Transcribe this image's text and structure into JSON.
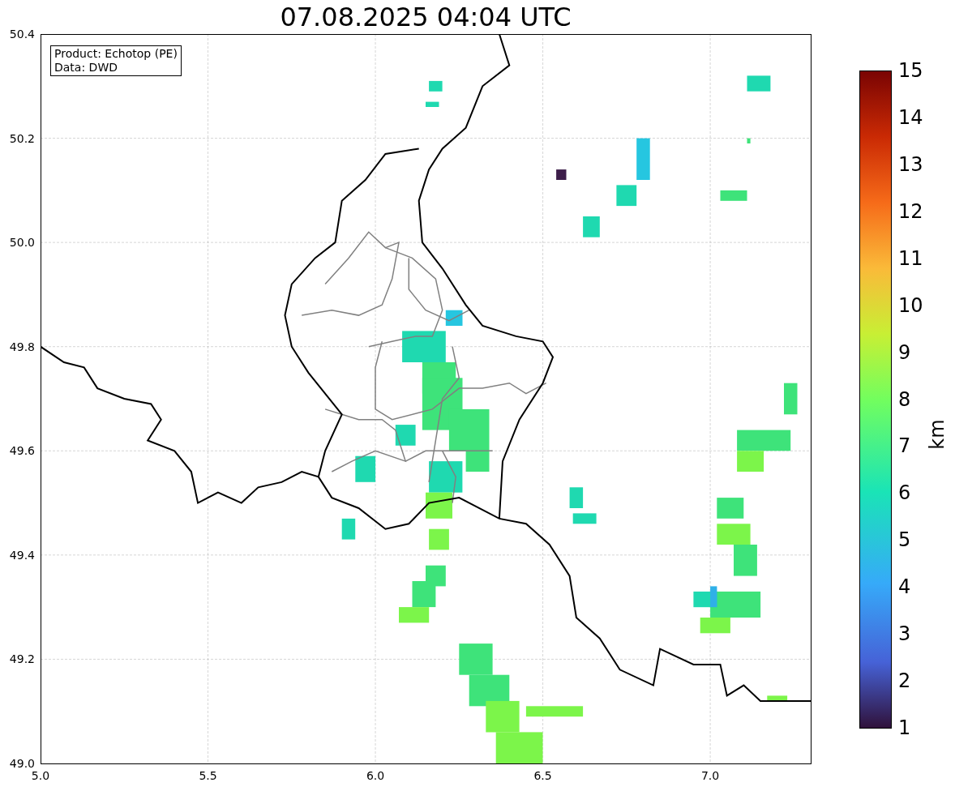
{
  "title": "07.08.2025 04:04 UTC",
  "info_box": [
    "Product: Echotop (PE)",
    "Data: DWD"
  ],
  "map": {
    "x_ticks": [
      "5.0",
      "5.5",
      "6.0",
      "6.5",
      "7.0"
    ],
    "y_ticks": [
      "50.4",
      "50.2",
      "50.0",
      "49.8",
      "49.6",
      "49.4",
      "49.2",
      "49.0"
    ]
  },
  "colorbar": {
    "label": "km",
    "ticks": [
      "15",
      "14",
      "13",
      "12",
      "11",
      "10",
      "9",
      "8",
      "7",
      "6",
      "5",
      "4",
      "3",
      "2",
      "1"
    ]
  }
}
